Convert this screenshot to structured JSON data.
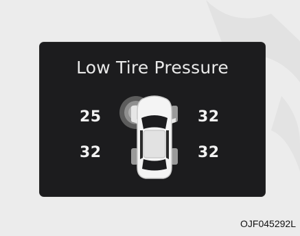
{
  "display": {
    "title": "Low Tire Pressure",
    "tires": {
      "front_left": "25",
      "front_right": "32",
      "rear_left": "32",
      "rear_right": "32"
    },
    "warning_tire": "front-left",
    "colors": {
      "panel": "#1c1c1e",
      "text": "#f2f2f2",
      "warning_halo": "#8f8f8f",
      "background": "#ececec"
    }
  },
  "figure_code": "OJF045292L"
}
